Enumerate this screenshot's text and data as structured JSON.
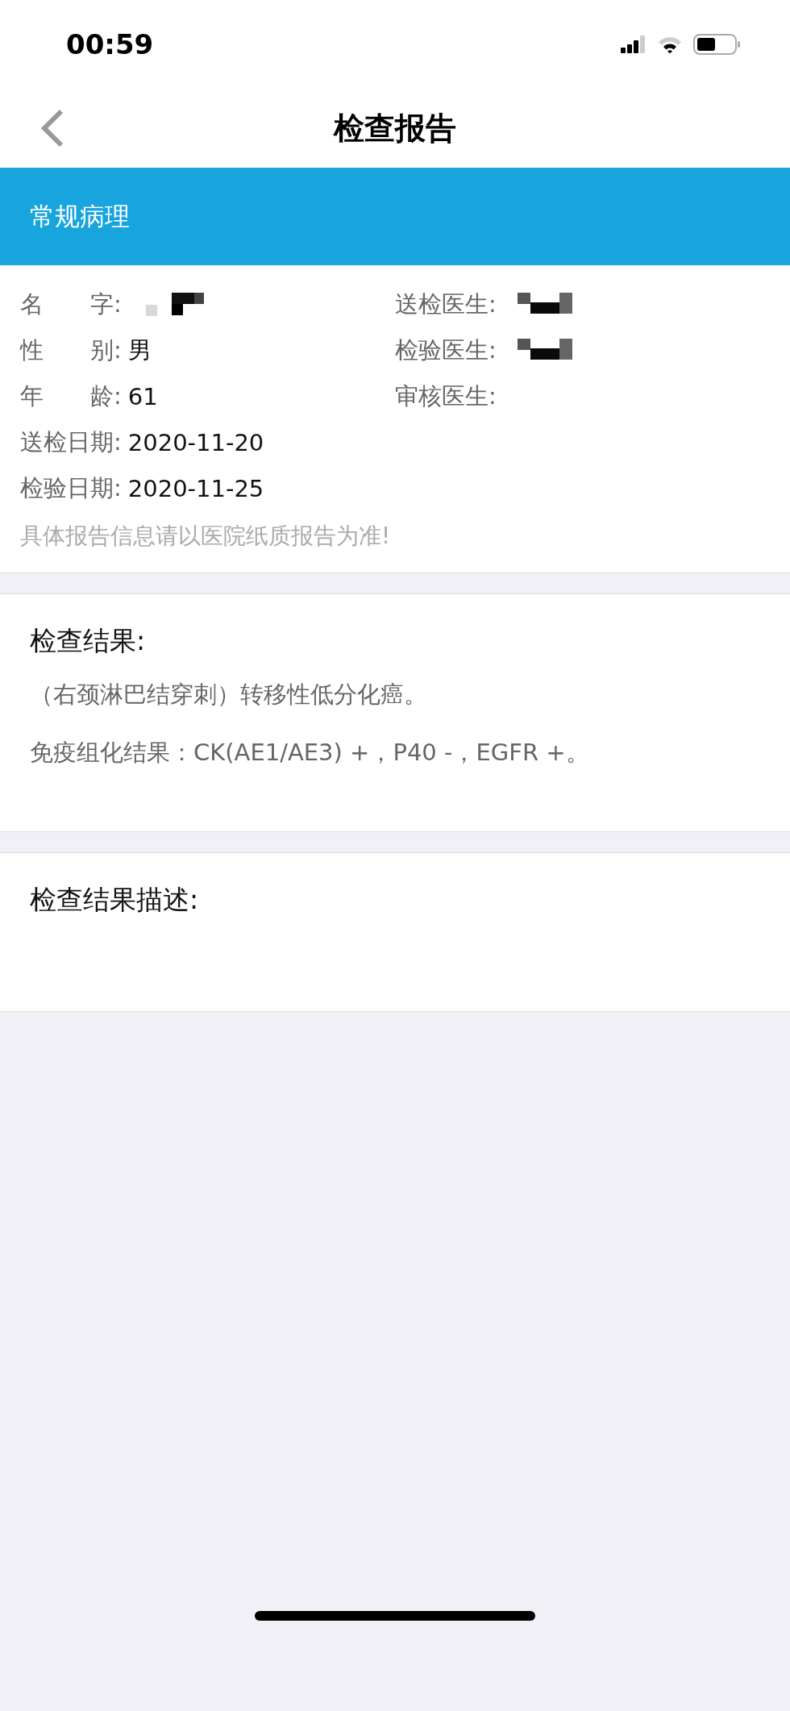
{
  "status_bar": {
    "time": "00:59"
  },
  "nav": {
    "title": "检查报告"
  },
  "section_banner": {
    "title": "常规病理"
  },
  "patient_info": {
    "left": [
      {
        "label": "名　　字:",
        "redacted": true
      },
      {
        "label": "性　　别:",
        "value": "男",
        "redacted": false
      },
      {
        "label": "年　　龄:",
        "value": "61",
        "redacted": false
      },
      {
        "label": "送检日期:",
        "value": "2020-11-20",
        "redacted": false
      },
      {
        "label": "检验日期:",
        "value": "2020-11-25",
        "redacted": false
      }
    ],
    "right": [
      {
        "label": "送检医生:",
        "redacted": true
      },
      {
        "label": "检验医生:",
        "redacted": true
      },
      {
        "label": "审核医生:",
        "redacted": false
      }
    ],
    "notice": "具体报告信息请以医院纸质报告为准!"
  },
  "results": {
    "heading": "检查结果:",
    "lines": [
      "（右颈淋巴结穿刺）转移性低分化癌。",
      "免疫组化结果：CK(AE1/AE3) +，P40 -，EGFR +。"
    ]
  },
  "description": {
    "heading": "检查结果描述:"
  }
}
